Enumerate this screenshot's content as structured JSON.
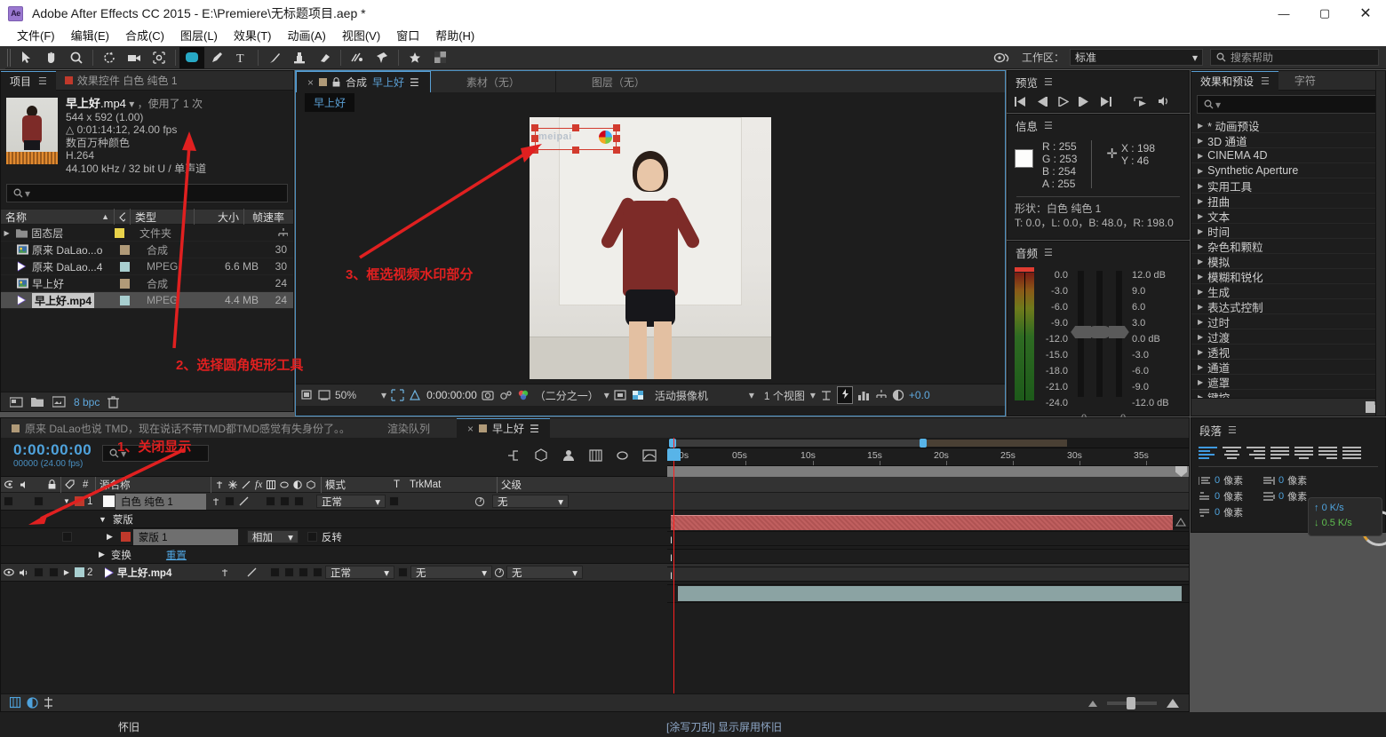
{
  "window": {
    "app_badge": "Ae",
    "title": "Adobe After Effects CC 2015 - E:\\Premiere\\无标题项目.aep *",
    "minimize": "—",
    "maximize": "▢",
    "close": "✕"
  },
  "menubar": [
    "文件(F)",
    "编辑(E)",
    "合成(C)",
    "图层(L)",
    "效果(T)",
    "动画(A)",
    "视图(V)",
    "窗口",
    "帮助(H)"
  ],
  "toolbar": {
    "tools": [
      {
        "name": "selection-tool",
        "icon": "cursor"
      },
      {
        "name": "hand-tool",
        "icon": "hand"
      },
      {
        "name": "zoom-tool",
        "icon": "magnifier"
      },
      {
        "name": "rotation-tool",
        "icon": "rotate"
      },
      {
        "name": "camera-tool",
        "icon": "camera"
      },
      {
        "name": "pan-behind-tool",
        "icon": "anchor"
      },
      {
        "name": "rounded-rectangle-tool",
        "icon": "rounded-rect"
      },
      {
        "name": "pen-tool",
        "icon": "pen"
      },
      {
        "name": "text-tool",
        "icon": "text"
      },
      {
        "name": "brush-tool",
        "icon": "brush"
      },
      {
        "name": "clone-stamp-tool",
        "icon": "stamp"
      },
      {
        "name": "eraser-tool",
        "icon": "eraser"
      },
      {
        "name": "roto-brush-tool",
        "icon": "roto"
      },
      {
        "name": "puppet-pin-tool",
        "icon": "pin"
      },
      {
        "name": "favorite-tool",
        "icon": "star"
      },
      {
        "name": "grid-tool",
        "icon": "checker"
      }
    ],
    "workspace_label": "工作区：",
    "workspace_value": "标准",
    "search_help": "搜索帮助"
  },
  "project": {
    "tabs": [
      {
        "label": "项目",
        "active": true
      },
      {
        "label": "效果控件 白色 纯色 1",
        "active": false
      }
    ],
    "asset": {
      "name": "早上好",
      "ext": ".mp4",
      "usage": "，使用了 1 次",
      "resolution": "544 x 592 (1.00)",
      "duration": "0:01:14:12, 24.00 fps",
      "colors": "数百万种颜色",
      "codec": "H.264",
      "audio": "44.100 kHz / 32 bit U / 单声道"
    },
    "columns": [
      "名称",
      "类型",
      "大小",
      "帧速率"
    ],
    "rows": [
      {
        "name": "固态层",
        "type": "文件夹",
        "size": "",
        "fps": "",
        "icon": "folder",
        "swatch": "#e8d24a",
        "selected": false
      },
      {
        "name": "原来 DaLao...o",
        "type": "合成",
        "size": "",
        "fps": "30",
        "icon": "comp",
        "swatch": "#b09a78",
        "selected": false
      },
      {
        "name": "原来 DaLao...4",
        "type": "MPEG",
        "size": "6.6 MB",
        "fps": "30",
        "icon": "video",
        "swatch": "#a8cfd0",
        "selected": false
      },
      {
        "name": "早上好",
        "type": "合成",
        "size": "",
        "fps": "24",
        "icon": "comp",
        "swatch": "#b09a78",
        "selected": false
      },
      {
        "name": "早上好.mp4",
        "type": "MPEG",
        "size": "4.4 MB",
        "fps": "24",
        "icon": "video",
        "swatch": "#a8cfd0",
        "selected": true
      }
    ],
    "footer_bpc": "8 bpc"
  },
  "composition": {
    "tabs": [
      {
        "label": "合成",
        "name": "早上好",
        "active": true
      },
      {
        "label": "素材（无）",
        "name": "",
        "active": false
      },
      {
        "label": "图层（无）",
        "name": "",
        "active": false
      }
    ],
    "chip": "早上好",
    "watermark_text": "meipai",
    "bottom": {
      "zoom": "50%",
      "timecode": "0:00:00:00",
      "resolution": "（二分之一）",
      "camera": "活动摄像机",
      "views": "1 个视图",
      "exposure": "+0.0"
    }
  },
  "preview": {
    "title": "预览"
  },
  "info": {
    "title": "信息",
    "r_label": "R :",
    "r": "255",
    "g_label": "G :",
    "g": "253",
    "b_label": "B :",
    "b": "254",
    "a_label": "A :",
    "a": "255",
    "x_label": "X :",
    "x": "198",
    "y_label": "Y :",
    "y": "46",
    "shape": "形状：白色 纯色 1",
    "bounds": "T: 0.0，L: 0.0，B: 48.0，R: 198.0"
  },
  "audio": {
    "title": "音频",
    "scale_left": [
      "0.0",
      "-3.0",
      "-6.0",
      "-9.0",
      "-12.0",
      "-15.0",
      "-18.0",
      "-21.0",
      "-24.0"
    ],
    "scale_right": [
      "12.0 dB",
      "9.0",
      "6.0",
      "3.0",
      "0.0 dB",
      "-3.0",
      "-6.0",
      "-9.0",
      "-12.0 dB"
    ],
    "fader_values": [
      "0",
      "0"
    ]
  },
  "effects": {
    "tabs": [
      {
        "label": "效果和预设",
        "active": true
      },
      {
        "label": "字符",
        "active": false
      }
    ],
    "categories": [
      "* 动画预设",
      "3D 通道",
      "CINEMA 4D",
      "Synthetic Aperture",
      "实用工具",
      "扭曲",
      "文本",
      "时间",
      "杂色和颗粒",
      "模拟",
      "模糊和锐化",
      "生成",
      "表达式控制",
      "过时",
      "过渡",
      "透视",
      "通道",
      "遮罩",
      "键控"
    ]
  },
  "paragraph": {
    "title": "段落",
    "fields": [
      {
        "icon": "indent-left",
        "value": "0",
        "unit": "像素"
      },
      {
        "icon": "indent-right",
        "value": "0",
        "unit": "像素"
      },
      {
        "icon": "space-before",
        "value": "0",
        "unit": "像素"
      },
      {
        "icon": "first-line-indent",
        "value": "0",
        "unit": "像素"
      },
      {
        "icon": "space-after",
        "value": "0",
        "unit": "像素"
      }
    ]
  },
  "speed_overlay": {
    "upload": "0 K/s",
    "download": "0.5 K/s"
  },
  "timeline": {
    "tabs": [
      {
        "label": "原来 DaLao也说 TMD，现在说话不带TMD都TMD感觉有失身份了。。",
        "active": false
      },
      {
        "label": "渲染队列",
        "active": false
      },
      {
        "label": "早上好",
        "active": true
      }
    ],
    "timecode": "0:00:00:00",
    "timecode_sub": "00000 (24.00 fps)",
    "columns": [
      "#",
      "源名称",
      "模式",
      "T",
      "TrkMat",
      "父级"
    ],
    "ruler_labels": [
      "0s",
      "05s",
      "10s",
      "15s",
      "20s",
      "25s",
      "30s",
      "35s"
    ],
    "rows": [
      {
        "kind": "layer",
        "index": "1",
        "name": "白色 纯色 1",
        "mode": "正常",
        "trkmat": "",
        "parent": "无",
        "swatch": "#c0392b",
        "bar": "red"
      },
      {
        "kind": "group",
        "label": "蒙版"
      },
      {
        "kind": "mask",
        "label": "蒙版 1",
        "blend": "相加",
        "invert": "反转",
        "swatch": "#c0392b"
      },
      {
        "kind": "transform",
        "label": "变换",
        "reset": "重置"
      },
      {
        "kind": "layer",
        "index": "2",
        "name": "早上好.mp4",
        "mode": "正常",
        "trkmat": "无",
        "parent": "无",
        "swatch": "#a8cfd0",
        "bar": "teal"
      }
    ]
  },
  "bottom_strip": {
    "left_label": "怀旧",
    "right_label": "[涂写刀刮] 显示屏用怀旧"
  },
  "annotations": [
    {
      "id": "ann-1",
      "text": "1、关闭显示"
    },
    {
      "id": "ann-2",
      "text": "2、选择圆角矩形工具"
    },
    {
      "id": "ann-3",
      "text": "3、框选视频水印部分"
    }
  ],
  "colors": {
    "accent_blue": "#4fa3dd",
    "annotation_red": "#e02020",
    "panel_bg": "#1d1d1d"
  }
}
